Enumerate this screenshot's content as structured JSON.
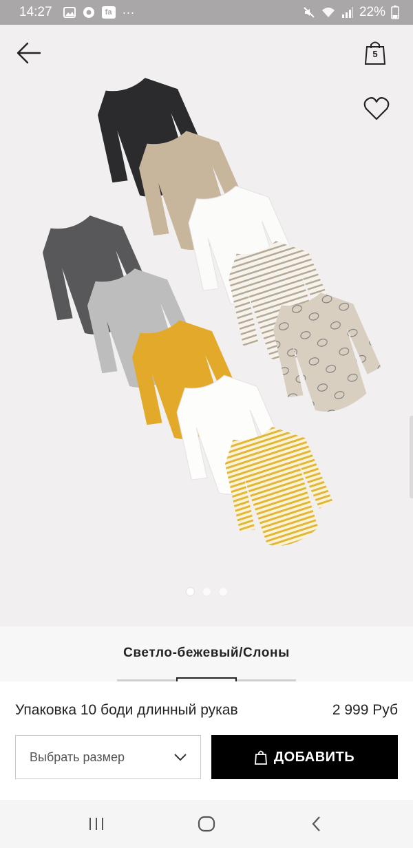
{
  "status_bar": {
    "time": "14:27",
    "notif_icon_text": "fa",
    "more": "···",
    "battery": "22%"
  },
  "header": {
    "bag_count": "5"
  },
  "gallery": {
    "total_images": 3,
    "active_index": 0
  },
  "product": {
    "color_name": "Светло-бежевый/Слоны",
    "name": "Упаковка 10 боди длинный рукав",
    "price": "2 999 Руб"
  },
  "actions": {
    "size_placeholder": "Выбрать размер",
    "add_label": "ДОБАВИТЬ"
  },
  "colors": {
    "black": "#000000",
    "brand_text": "#222222",
    "status_bg": "#a9a7a7"
  }
}
